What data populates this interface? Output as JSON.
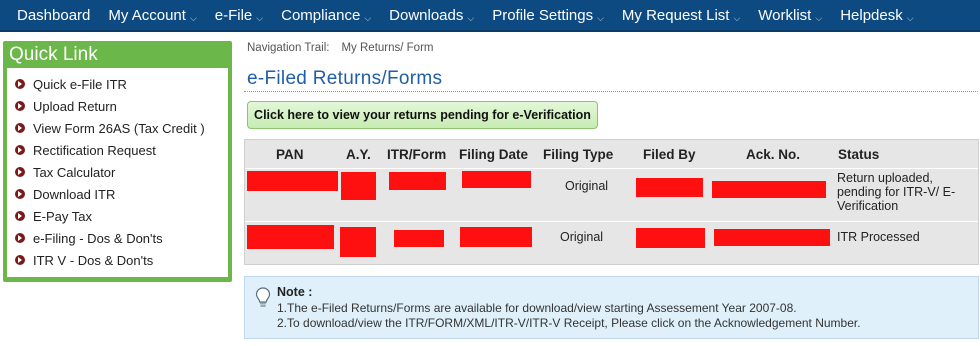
{
  "nav": {
    "items": [
      {
        "label": "Dashboard",
        "caret": false
      },
      {
        "label": "My Account",
        "caret": true
      },
      {
        "label": "e-File",
        "caret": true
      },
      {
        "label": "Compliance",
        "caret": true
      },
      {
        "label": "Downloads",
        "caret": true
      },
      {
        "label": "Profile Settings",
        "caret": true
      },
      {
        "label": "My Request List",
        "caret": true
      },
      {
        "label": "Worklist",
        "caret": true
      },
      {
        "label": "Helpdesk",
        "caret": true
      }
    ]
  },
  "quick_link": {
    "title": "Quick Link",
    "items": [
      "Quick e-File ITR",
      "Upload Return",
      "View Form 26AS (Tax Credit )",
      "Rectification Request",
      "Tax Calculator",
      "Download ITR",
      "E-Pay Tax",
      "e-Filing - Dos & Don'ts",
      "ITR V - Dos & Don'ts"
    ]
  },
  "breadcrumb": {
    "label": "Navigation Trail:",
    "path": "My Returns/ Form"
  },
  "page_title": "e-Filed Returns/Forms",
  "pending_button": "Click here to view your returns pending for e-Verification",
  "table": {
    "headers": [
      "PAN",
      "A.Y.",
      "ITR/Form",
      "Filing Date",
      "Filing Type",
      "Filed By",
      "Ack. No.",
      "Status"
    ],
    "rows": [
      {
        "filing_type": "Original",
        "status_lines": [
          "Return uploaded,",
          "pending for ITR-V/ E-",
          "Verification"
        ]
      },
      {
        "filing_type": "Original",
        "status_lines": [
          "ITR Processed"
        ]
      }
    ],
    "redaction_color": "#ff1010"
  },
  "note": {
    "title": "Note :",
    "lines": [
      "1.The e-Filed Returns/Forms are available for download/view starting Assessement Year 2007-08.",
      "2.To download/view the ITR/FORM/XML/ITR-V/ITR-V Receipt, Please click on the Acknowledgement Number."
    ],
    "icon": "lightbulb-icon"
  },
  "colors": {
    "nav_bg": "#0d4a82",
    "quick_link_green": "#6cb74a",
    "title_blue": "#1f5ea8",
    "note_bg": "#dff0fb"
  }
}
